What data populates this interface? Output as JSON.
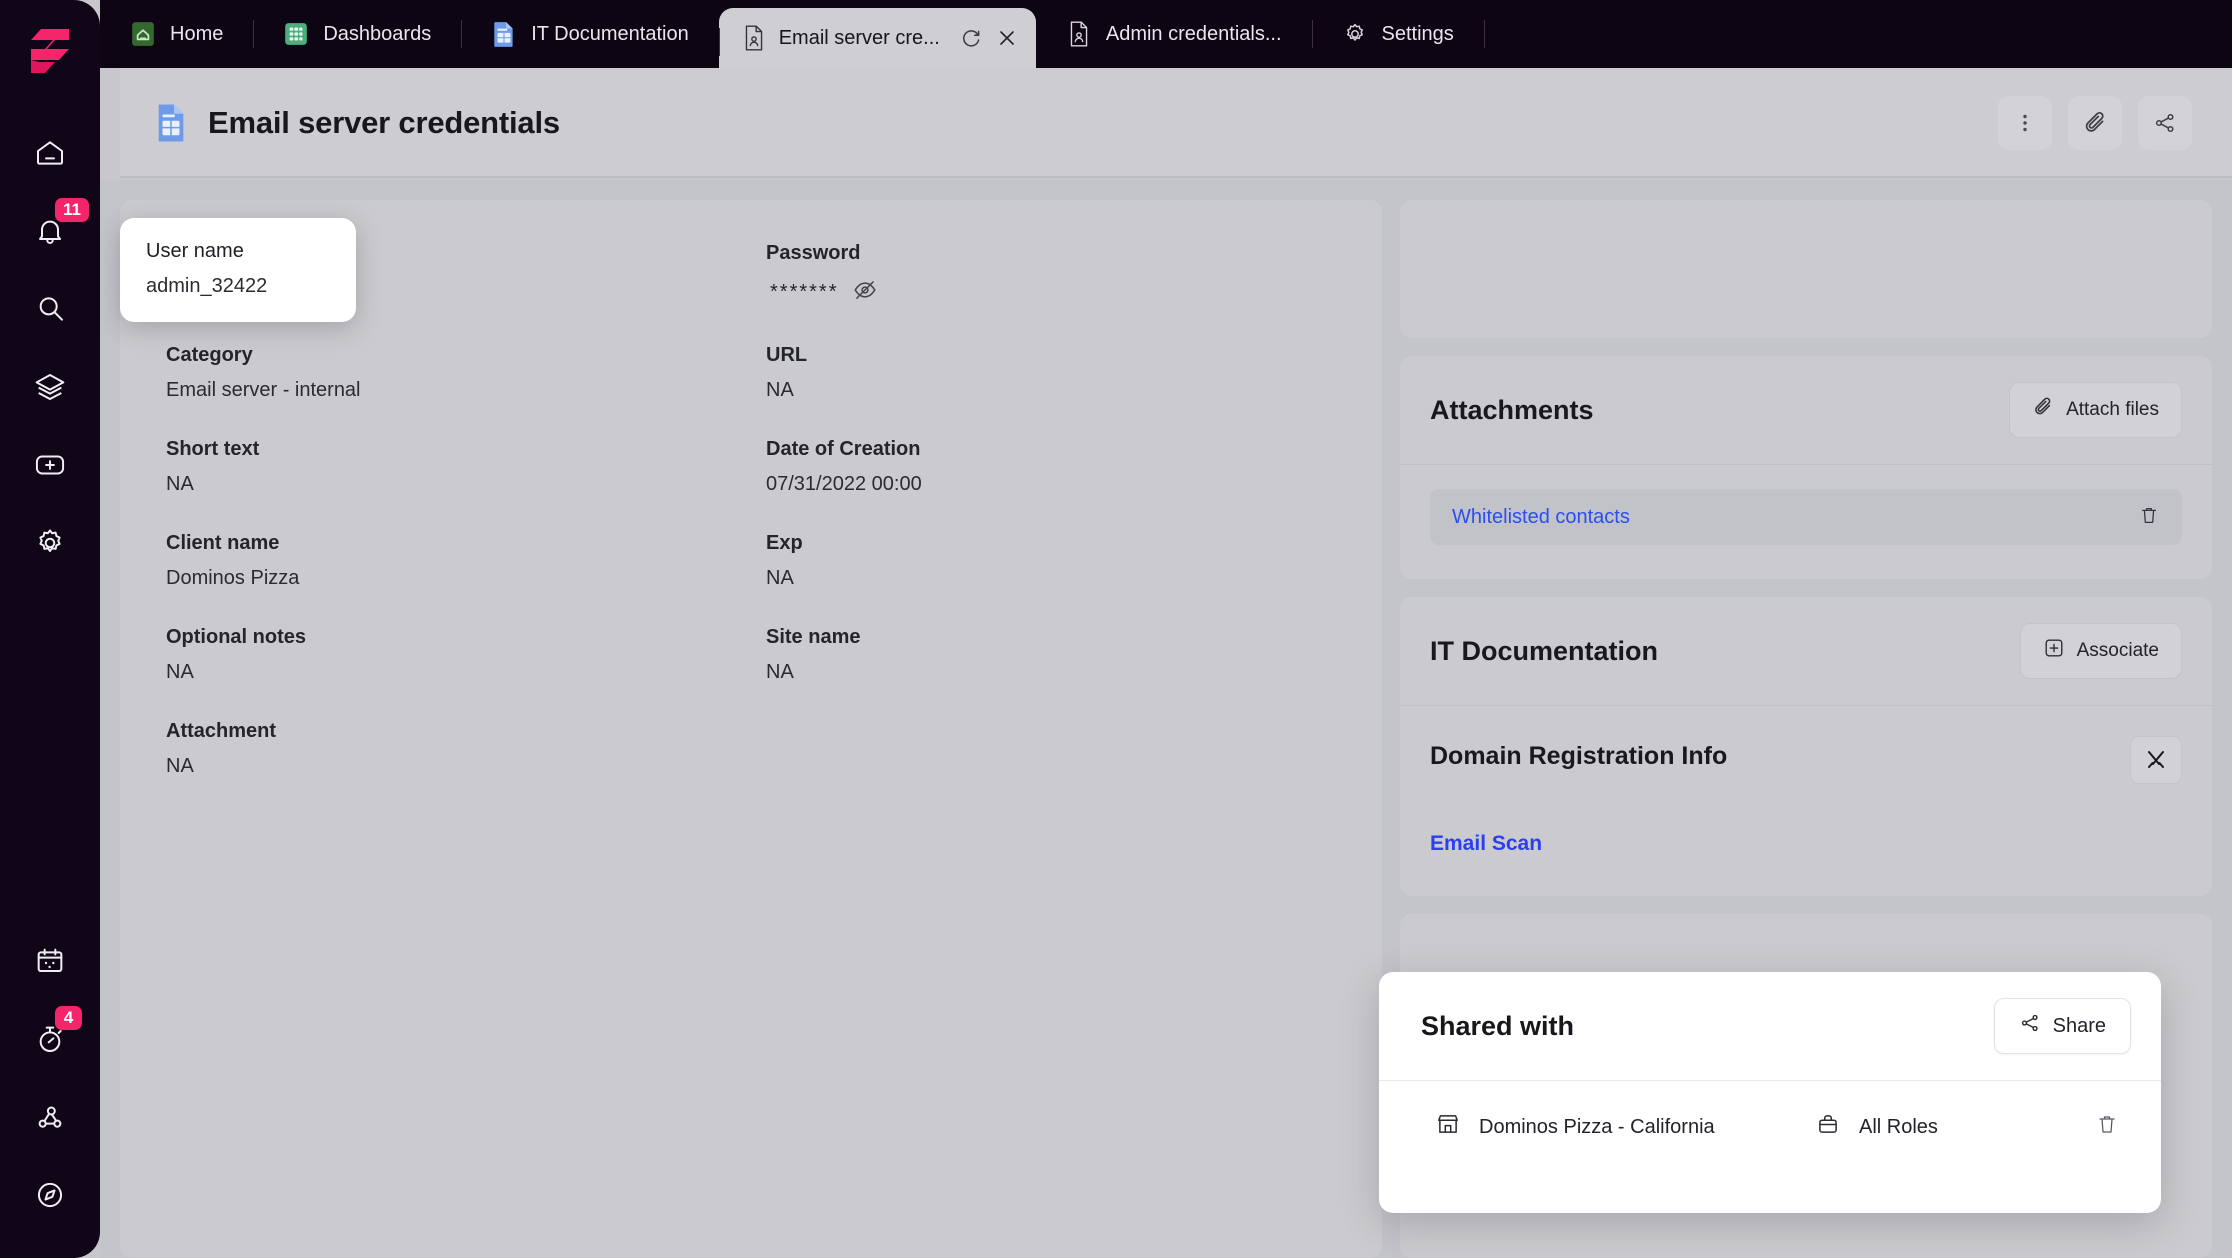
{
  "app": {
    "logo_name": "superops-logo",
    "rail_items": [
      {
        "name": "home-icon",
        "badge": null
      },
      {
        "name": "notifications-bell-icon",
        "badge": "11"
      },
      {
        "name": "search-icon",
        "badge": null
      },
      {
        "name": "layers-icon",
        "badge": null
      },
      {
        "name": "add-plus-icon",
        "badge": null
      },
      {
        "name": "gear-settings-icon",
        "badge": null
      }
    ],
    "rail_items_bottom": [
      {
        "name": "calendar-icon",
        "badge": null
      },
      {
        "name": "stopwatch-timer-icon",
        "badge": "4"
      },
      {
        "name": "network-share-icon",
        "badge": null
      },
      {
        "name": "compass-icon",
        "badge": null
      }
    ]
  },
  "tabbar": {
    "tabs": [
      {
        "label": "Home",
        "icon": "home-doc-icon",
        "active": false
      },
      {
        "label": "Dashboards",
        "icon": "dashboard-grid-icon",
        "active": false
      },
      {
        "label": "IT Documentation",
        "icon": "it-doc-icon",
        "active": false
      },
      {
        "label": "Email server cre...",
        "icon": "credential-doc-icon",
        "active": true
      },
      {
        "label": "Admin credentials...",
        "icon": "credential-doc-icon",
        "active": false
      },
      {
        "label": "Settings",
        "icon": "gear-settings-icon",
        "active": false
      }
    ],
    "active_tab_actions": [
      {
        "name": "refresh-icon",
        "glyph": "⟳"
      },
      {
        "name": "close-tab-icon",
        "glyph": "✕"
      }
    ]
  },
  "header": {
    "icon": "credential-doc-icon",
    "title": "Email server credentials",
    "actions": [
      {
        "name": "more-options-icon"
      },
      {
        "name": "attachment-paperclip-icon"
      },
      {
        "name": "share-nodes-icon"
      }
    ]
  },
  "details": {
    "fields": [
      {
        "label": "User name",
        "value": "admin_32422",
        "floating": true
      },
      {
        "label": "Password",
        "value": "*******",
        "masked": true,
        "toggle_icon": "eye-off-icon"
      },
      {
        "label": "Category",
        "value": "Email server - internal"
      },
      {
        "label": "URL",
        "value": "NA"
      },
      {
        "label": "Short text",
        "value": "NA"
      },
      {
        "label": "Date of Creation",
        "value": "07/31/2022 00:00"
      },
      {
        "label": "Client name",
        "value": "Dominos Pizza"
      },
      {
        "label": "Exp",
        "value": "NA"
      },
      {
        "label": "Optional notes",
        "value": "NA"
      },
      {
        "label": "Site name",
        "value": "NA"
      },
      {
        "label": "Attachment",
        "value": "NA"
      }
    ]
  },
  "attachments": {
    "title": "Attachments",
    "button_label": "Attach files",
    "button_icon": "paperclip-icon",
    "items": [
      {
        "name": "Whitelisted contacts",
        "delete_icon": "trash-icon"
      }
    ]
  },
  "it_documentation": {
    "title": "IT Documentation",
    "button_label": "Associate",
    "button_icon": "plus-square-icon",
    "section_title": "Domain Registration Info",
    "section_tool_icon": "tools-icon",
    "link_label": "Email Scan"
  },
  "shared_with": {
    "title": "Shared with",
    "button_label": "Share",
    "button_icon": "share-nodes-icon",
    "rows": [
      {
        "org_icon": "storefront-icon",
        "org": "Dominos Pizza - California",
        "role_icon": "briefcase-icon",
        "role": "All Roles",
        "delete_icon": "trash-icon"
      }
    ]
  },
  "colors": {
    "rail_bg": "#110618",
    "tabbar_bg": "#0d0513",
    "accent_pink": "#f4256a",
    "link_blue": "#2b4ef0",
    "panel_bg": "#cbcbcf",
    "body_bg": "#c4c4cb"
  }
}
